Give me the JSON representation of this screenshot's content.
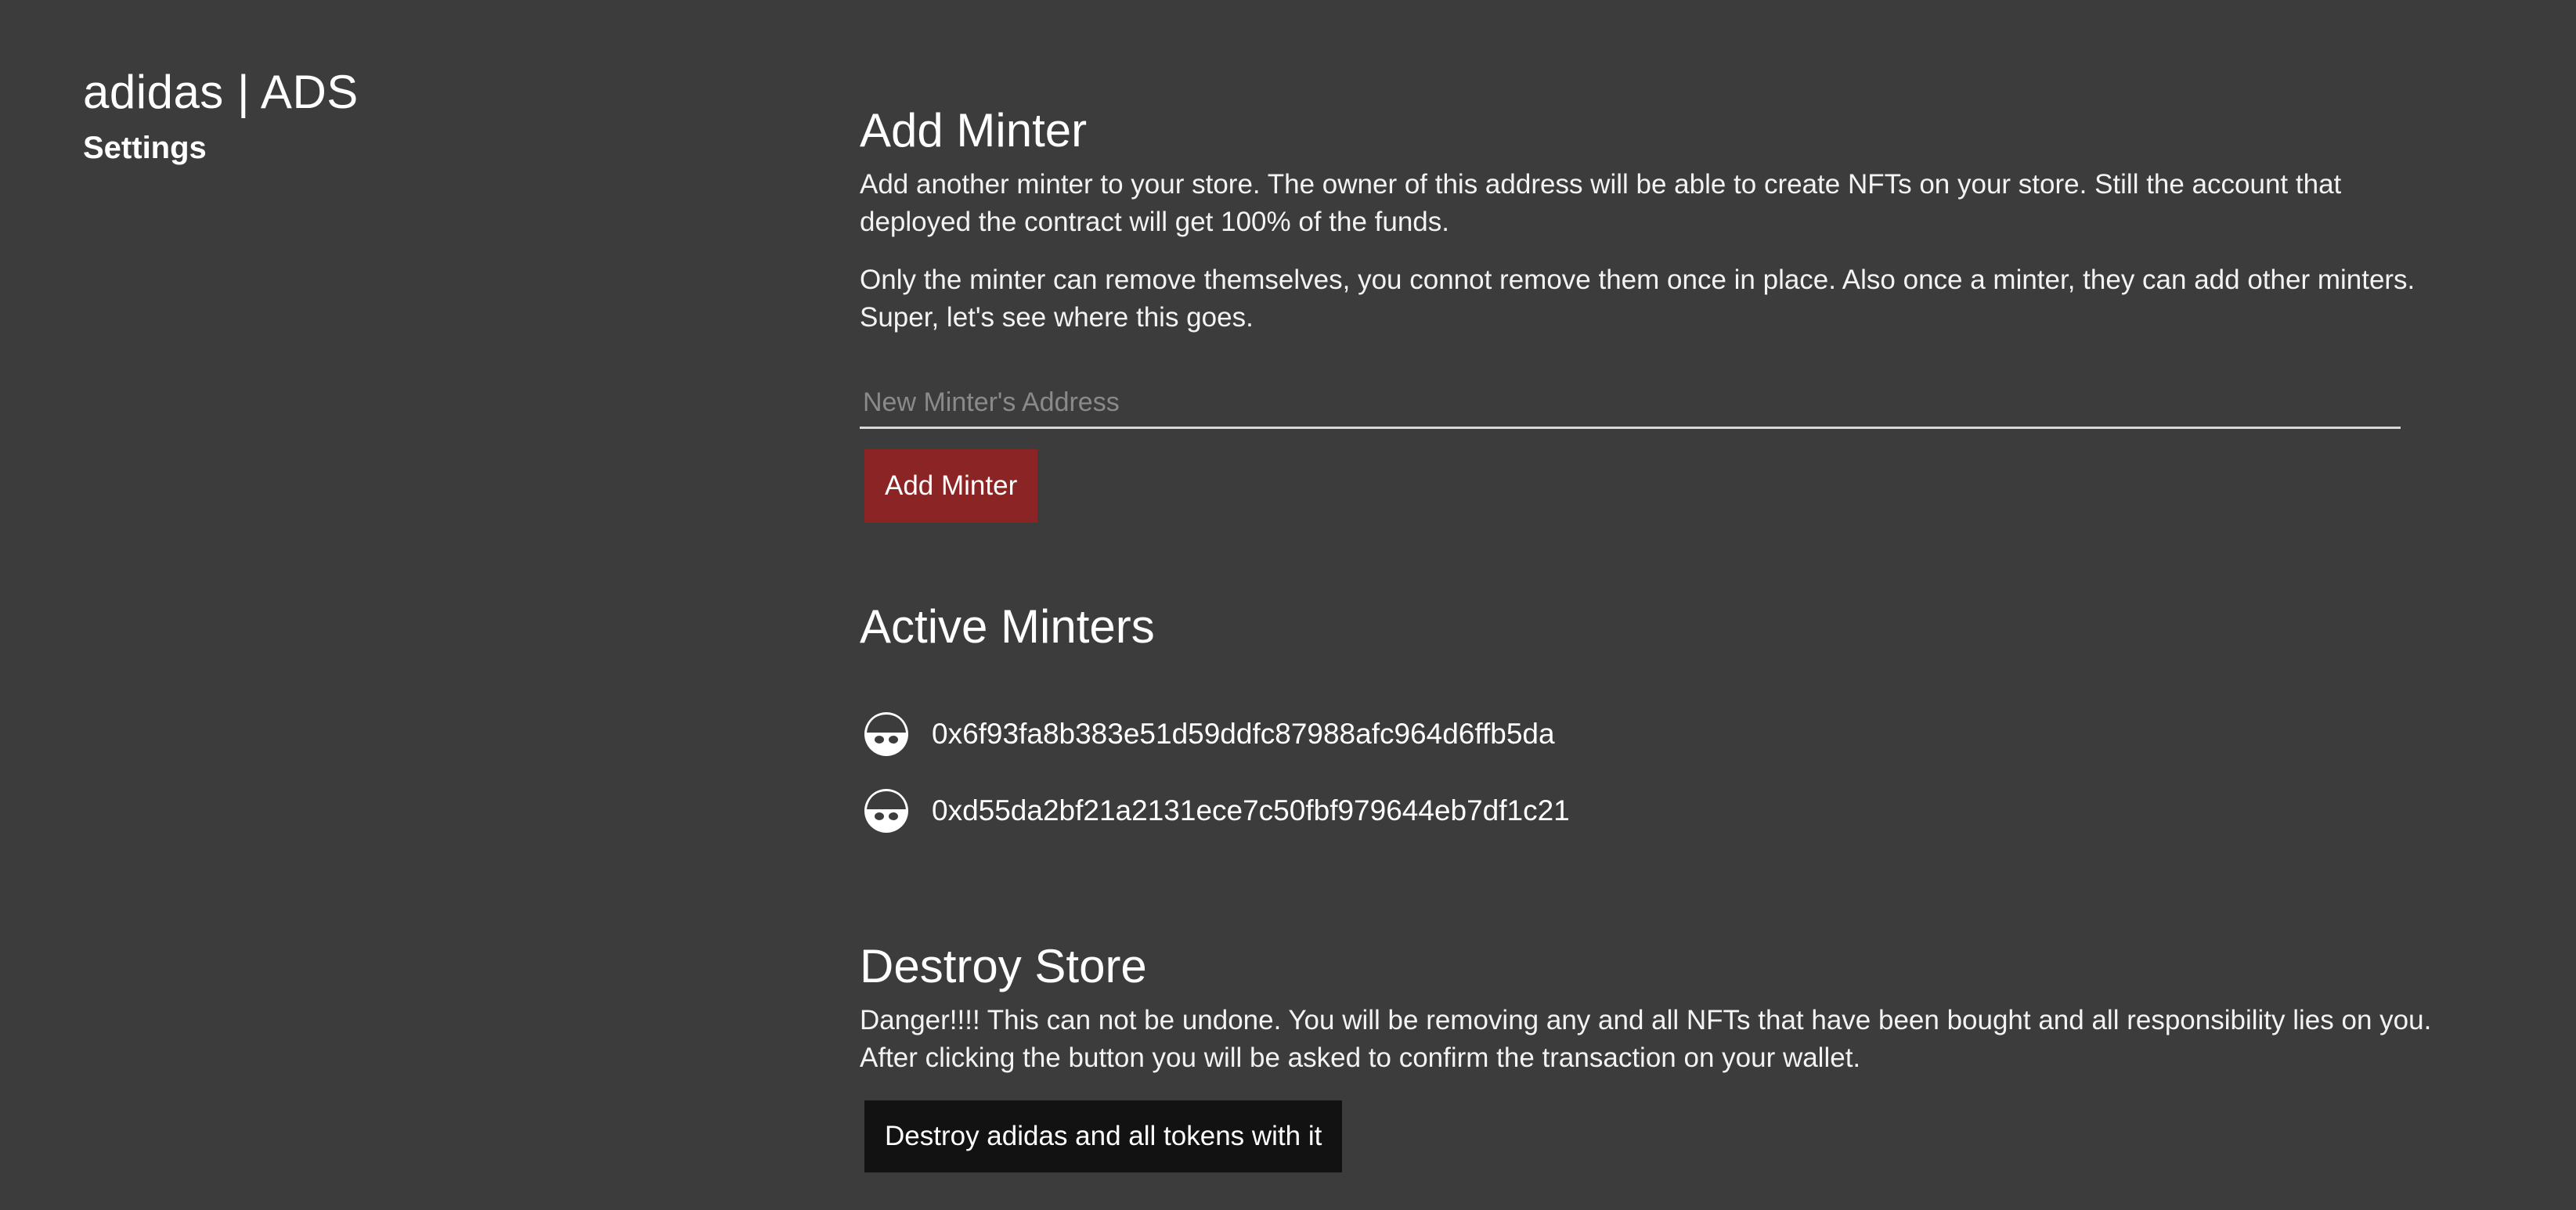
{
  "sidebar": {
    "store_title": "adidas | ADS",
    "settings_link": "Settings"
  },
  "add_minter": {
    "title": "Add Minter",
    "description_1": "Add another minter to your store. The owner of this address will be able to create NFTs on your store. Still the account that deployed the contract will get 100% of the funds.",
    "description_2": "Only the minter can remove themselves, you connot remove them once in place. Also once a minter, they can add other minters. Super, let's see where this goes.",
    "input_placeholder": "New Minter's Address",
    "input_value": "",
    "button_label": "Add Minter"
  },
  "active_minters": {
    "title": "Active Minters",
    "avatar_icon": "user-avatar-icon",
    "items": [
      {
        "address": "0x6f93fa8b383e51d59ddfc87988afc964d6ffb5da"
      },
      {
        "address": "0xd55da2bf21a2131ece7c50fbf979644eb7df1c21"
      }
    ]
  },
  "destroy_store": {
    "title": "Destroy Store",
    "description": "Danger!!!! This can not be undone. You will be removing any and all NFTs that have been bought and all responsibility lies on you. After clicking the button you will be asked to confirm the transaction on your wallet.",
    "button_label": "Destroy adidas and all tokens with it"
  },
  "colors": {
    "background": "#3c3c3c",
    "primary_button": "#8b2525",
    "danger_button": "#121212",
    "text": "#ffffff"
  }
}
